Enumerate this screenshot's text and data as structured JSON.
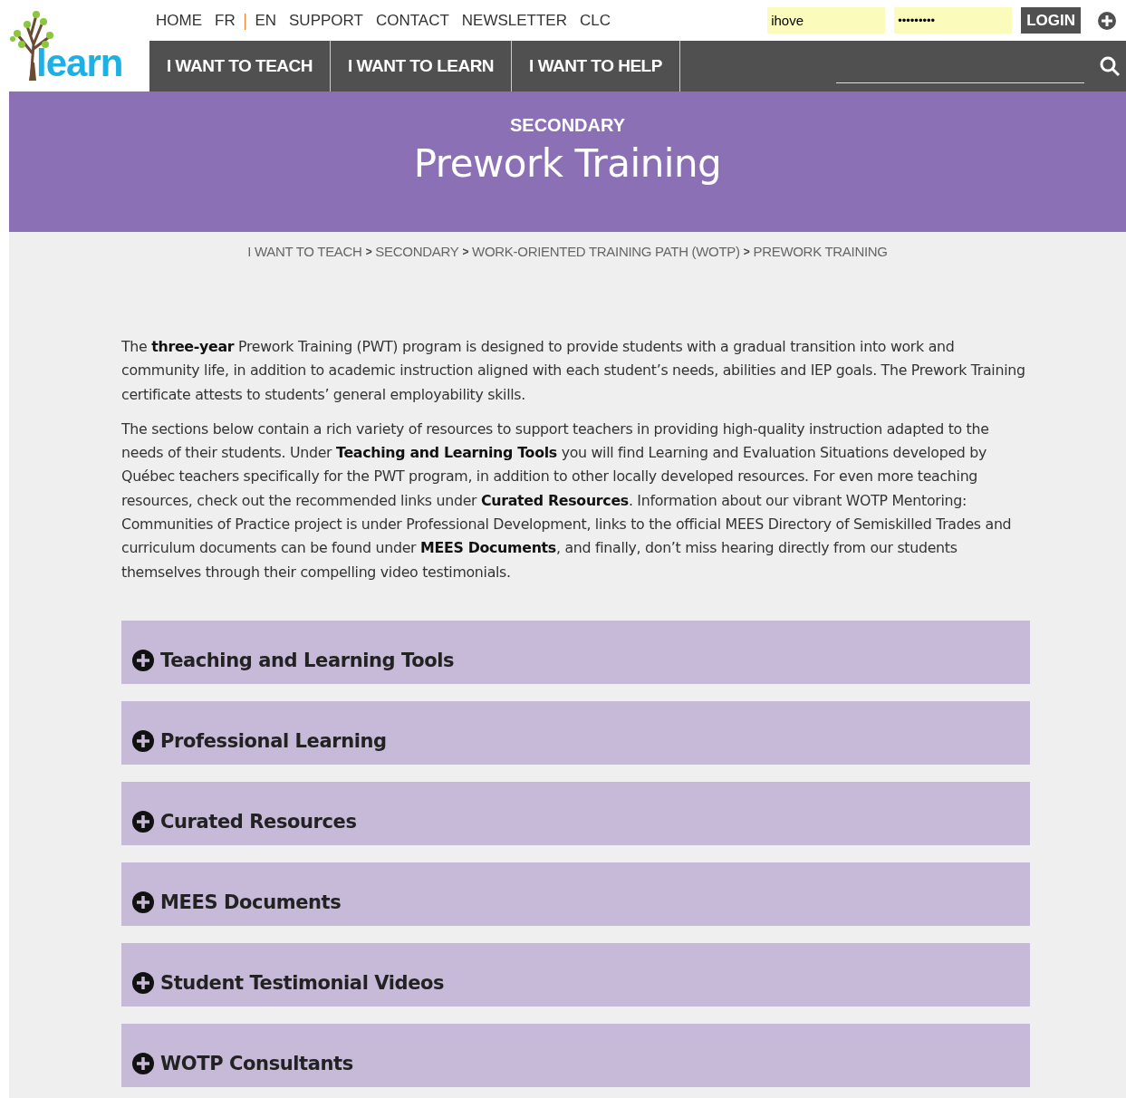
{
  "logo": {
    "text": "learn"
  },
  "top_links": [
    {
      "kind": "link",
      "label": "HOME"
    },
    {
      "kind": "link",
      "label": "FR"
    },
    {
      "kind": "separator",
      "label": "|"
    },
    {
      "kind": "link",
      "label": "EN"
    },
    {
      "kind": "link",
      "label": "SUPPORT"
    },
    {
      "kind": "link",
      "label": "CONTACT"
    },
    {
      "kind": "link",
      "label": "NEWSLETTER"
    },
    {
      "kind": "link",
      "label": "CLC"
    }
  ],
  "login": {
    "username": "ihove",
    "password": "•••••••••",
    "button": "LOGIN"
  },
  "nav": [
    {
      "label": "I WANT TO TEACH"
    },
    {
      "label": "I WANT TO LEARN"
    },
    {
      "label": "I WANT TO HELP"
    }
  ],
  "banner": {
    "subtitle": "SECONDARY",
    "title": "Prework Training"
  },
  "breadcrumb": [
    {
      "kind": "link",
      "label": "I WANT TO TEACH"
    },
    {
      "kind": "separator",
      "label": ">"
    },
    {
      "kind": "link",
      "label": "SECONDARY"
    },
    {
      "kind": "separator",
      "label": ">"
    },
    {
      "kind": "link",
      "label": "WORK-ORIENTED TRAINING PATH (WOTP)"
    },
    {
      "kind": "separator",
      "label": ">"
    },
    {
      "kind": "link",
      "label": "PREWORK TRAINING"
    }
  ],
  "paragraphs": [
    "The **three-year** Prework Training (PWT) program is designed to provide students with a gradual transition into work and community life, in addition to academic instruction aligned with each student’s needs, abilities and IEP goals. The Prework Training certificate attests to students’ general employability skills.",
    "The sections below contain a rich variety of resources to support teachers in providing high-quality instruction adapted to the needs of their students. Under **Teaching and Learning Tools** you will find Learning and Evaluation Situations developed by Québec teachers specifically for the PWT program, in addition to other locally developed resources. For even more teaching resources, check out the recommended links under **Curated Resources**. Information about our vibrant WOTP Mentoring: Communities of Practice project is under Professional Development, links to the official MEES Directory of Semiskilled Trades and curriculum documents can be found under **MEES Documents**, and finally, don’t miss hearing directly from our students themselves through their compelling video testimonials."
  ],
  "sections": [
    {
      "title": "Teaching and Learning Tools",
      "expanded": false
    },
    {
      "title": "Professional Learning",
      "expanded": false
    },
    {
      "title": "Curated Resources",
      "expanded": false
    },
    {
      "title": "MEES Documents",
      "expanded": false
    },
    {
      "title": "Student Testimonial Videos",
      "expanded": false
    },
    {
      "title": "WOTP Consultants",
      "expanded": false
    }
  ]
}
